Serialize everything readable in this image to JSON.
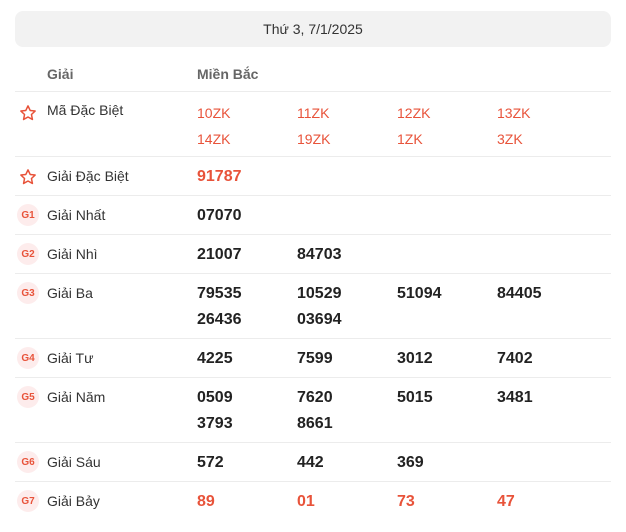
{
  "date_label": "Thứ 3, 7/1/2025",
  "header": {
    "col_title": "Giải",
    "col_region": "Miền Bắc"
  },
  "colors": {
    "accent": "#e8533a",
    "badge_bg": "#fdecec",
    "date_bg": "#f2f2f2"
  },
  "rows": [
    {
      "icon": "star-icon",
      "name": "Mã Đặc Biệt",
      "values": [
        "10ZK",
        "11ZK",
        "12ZK",
        "13ZK",
        "14ZK",
        "19ZK",
        "1ZK",
        "3ZK"
      ]
    },
    {
      "icon": "star-icon",
      "name": "Giải Đặc Biệt",
      "values": [
        "91787"
      ]
    },
    {
      "badge": "G1",
      "name": "Giải Nhất",
      "values": [
        "07070"
      ]
    },
    {
      "badge": "G2",
      "name": "Giải Nhì",
      "values": [
        "21007",
        "84703"
      ]
    },
    {
      "badge": "G3",
      "name": "Giải Ba",
      "values": [
        "79535",
        "10529",
        "51094",
        "84405",
        "26436",
        "03694"
      ]
    },
    {
      "badge": "G4",
      "name": "Giải Tư",
      "values": [
        "4225",
        "7599",
        "3012",
        "7402"
      ]
    },
    {
      "badge": "G5",
      "name": "Giải Năm",
      "values": [
        "0509",
        "7620",
        "5015",
        "3481",
        "3793",
        "8661"
      ]
    },
    {
      "badge": "G6",
      "name": "Giải Sáu",
      "values": [
        "572",
        "442",
        "369"
      ]
    },
    {
      "badge": "G7",
      "name": "Giải Bảy",
      "values": [
        "89",
        "01",
        "73",
        "47"
      ]
    }
  ]
}
